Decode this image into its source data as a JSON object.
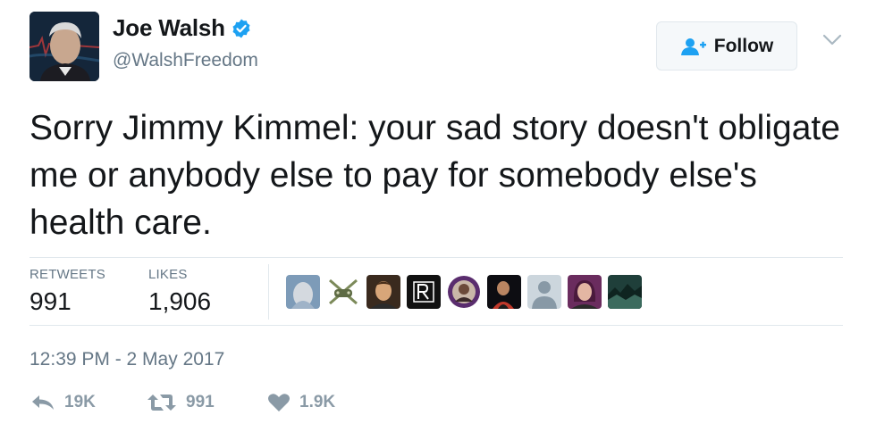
{
  "author": {
    "display_name": "Joe Walsh",
    "handle": "@WalshFreedom",
    "verified": true,
    "verified_icon": "verified-badge-icon",
    "verified_color": "#1da1f2"
  },
  "follow_button": {
    "label": "Follow",
    "icon": "add-user-icon",
    "icon_color": "#1da1f2"
  },
  "more_menu": {
    "icon": "chevron-down-icon"
  },
  "tweet": {
    "text": "Sorry Jimmy Kimmel: your sad story doesn't obligate me or anybody else to pay for somebody else's health care."
  },
  "stats": {
    "retweets_label": "RETWEETS",
    "retweets_value": "991",
    "likes_label": "LIKES",
    "likes_value": "1,906"
  },
  "likers_count_shown": 9,
  "timestamp": "12:39 PM - 2 May 2017",
  "actions": {
    "reply": {
      "icon": "reply-icon",
      "count": "19K"
    },
    "retweet": {
      "icon": "retweet-icon",
      "count": "991"
    },
    "like": {
      "icon": "heart-icon",
      "count": "1.9K"
    }
  },
  "colors": {
    "text_primary": "#14171a",
    "text_secondary": "#657786",
    "action_gray": "#8a9aa6",
    "accent": "#1da1f2"
  }
}
